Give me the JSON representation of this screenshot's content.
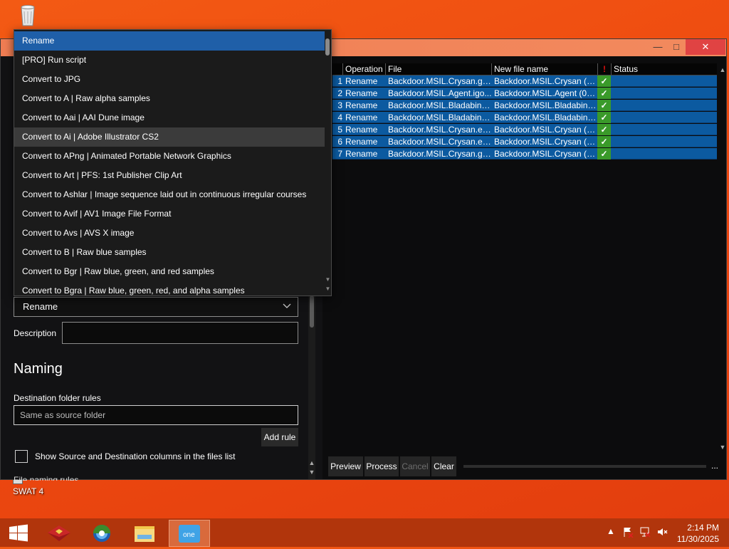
{
  "desktop": {
    "recycle_bin_icon": "recycle-bin-icon",
    "shortcut_label": "SWAT 4"
  },
  "window": {
    "close_glyph": "✕",
    "maximize_glyph": "□",
    "minimize_glyph": "—"
  },
  "left": {
    "operation_value": "Rename",
    "description_label": "Description",
    "naming_heading": "Naming",
    "destination_label": "Destination folder rules",
    "destination_value": "Same as source folder",
    "add_rule_label": "Add rule",
    "show_columns_label": "Show Source and Destination columns in the files list",
    "file_naming_rules_label": "File naming rules"
  },
  "dropdown": {
    "items": [
      "Rename",
      "[PRO] Run script",
      "Convert to JPG",
      "Convert to A | Raw alpha samples",
      "Convert to Aai | AAI Dune image",
      "Convert to Ai | Adobe Illustrator CS2",
      "Convert to APng | Animated Portable Network Graphics",
      "Convert to Art | PFS: 1st Publisher Clip Art",
      "Convert to Ashlar | Image sequence laid out in continuous irregular courses",
      "Convert to Avif | AV1 Image File Format",
      "Convert to Avs | AVS X image",
      "Convert to B | Raw blue samples",
      "Convert to Bgr | Raw blue, green, and red samples",
      "Convert to Bgra | Raw blue, green, red, and alpha samples"
    ],
    "selected_index": 0,
    "hover_index": 5
  },
  "table": {
    "headers": {
      "operation": "Operation",
      "file": "File",
      "new_name": "New file name",
      "flag": "!",
      "status": "Status"
    },
    "rows": [
      {
        "n": "1",
        "op": "Rename",
        "file": "Backdoor.MSIL.Crysan.gt...",
        "new": "Backdoor.MSIL.Crysan (01...",
        "ok": "✓"
      },
      {
        "n": "2",
        "op": "Rename",
        "file": "Backdoor.MSIL.Agent.igo...",
        "new": "Backdoor.MSIL.Agent (02)...",
        "ok": "✓"
      },
      {
        "n": "3",
        "op": "Rename",
        "file": "Backdoor.MSIL.Bladabind...",
        "new": "Backdoor.MSIL.Bladabind...",
        "ok": "✓"
      },
      {
        "n": "4",
        "op": "Rename",
        "file": "Backdoor.MSIL.Bladabind...",
        "new": "Backdoor.MSIL.Bladabind...",
        "ok": "✓"
      },
      {
        "n": "5",
        "op": "Rename",
        "file": "Backdoor.MSIL.Crysan.ecy...",
        "new": "Backdoor.MSIL.Crysan (05...",
        "ok": "✓"
      },
      {
        "n": "6",
        "op": "Rename",
        "file": "Backdoor.MSIL.Crysan.ecy...",
        "new": "Backdoor.MSIL.Crysan (06...",
        "ok": "✓"
      },
      {
        "n": "7",
        "op": "Rename",
        "file": "Backdoor.MSIL.Crysan.gr...",
        "new": "Backdoor.MSIL.Crysan (07...",
        "ok": "✓"
      }
    ]
  },
  "actions": {
    "preview": "Preview",
    "process": "Process",
    "cancel": "Cancel",
    "clear": "Clear",
    "more": "..."
  },
  "taskbar": {
    "time": "2:14 PM",
    "date": "11/30/2025",
    "pinned_icons": [
      "start-icon",
      "app-box-icon",
      "browser-icon",
      "file-explorer-icon",
      "onecommander-icon"
    ]
  },
  "colors": {
    "desktop": "#ef4d10",
    "selection": "#0c5aa0",
    "dropdown_selected": "#1f5fa8",
    "success": "#3a9a2a",
    "taskbar": "#b1350c"
  }
}
